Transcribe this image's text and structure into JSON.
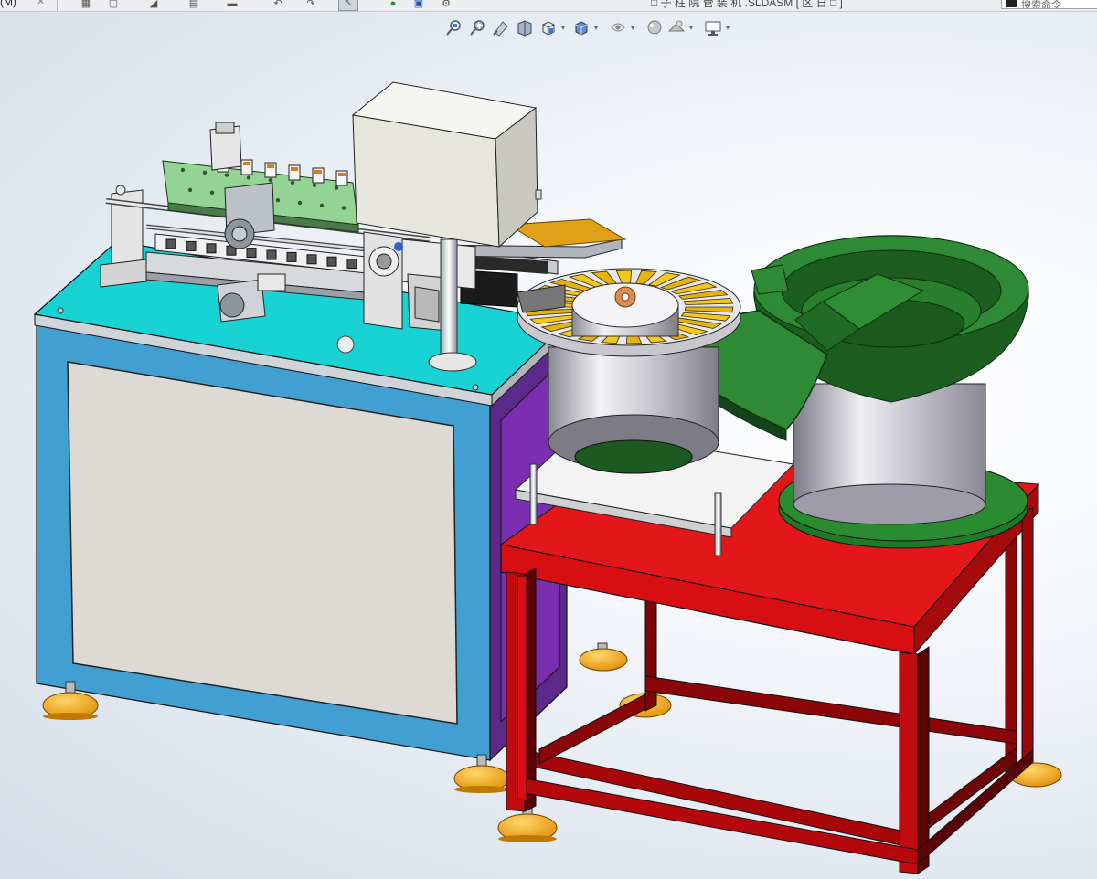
{
  "menu": {
    "label": "(M)",
    "pin": "✕"
  },
  "toolbar": {
    "icons": [
      "grid-icon",
      "new-doc-icon",
      "rebuild-icon",
      "print-icon",
      "save-icon",
      "undo-icon",
      "redo-icon",
      "select-icon",
      "traffic-light-icon",
      "options-icon",
      "settings-gear-icon"
    ],
    "document_title": "□ 子 柱 院 管 装 机 .SLDASM [ 区 日 □ ]",
    "search_placeholder": "搜索命令"
  },
  "view_toolbar": {
    "buttons": [
      "zoom-to-fit-icon",
      "zoom-to-area-icon",
      "previous-view-icon",
      "section-view-icon",
      "view-orientation-icon",
      "display-style-icon",
      "hide-show-items-icon",
      "edit-appearance-icon",
      "apply-scene-icon",
      "view-settings-icon"
    ]
  },
  "scene": {
    "name": "Assembly model viewport",
    "colors": {
      "cabinet_front": "#429fd1",
      "cabinet_side": "#5b2a8a",
      "tabletop": "#18d2d3",
      "cabinet_panel": "#dcdad2",
      "stand_frame": "#b4080c",
      "stand_frame_dark": "#5a0408",
      "stand_top": "#d80f12",
      "feeder_bowl": "#1f7a26",
      "feeder_dark": "#0d4a12",
      "feeder_cylinder": "#b9b8c2",
      "feet": "#f4a91a",
      "housing_box": "#e6e6dc",
      "fixture_plate": "#93d393",
      "gold_parts": "#f0c21a",
      "chute": "#e0a01a"
    }
  }
}
